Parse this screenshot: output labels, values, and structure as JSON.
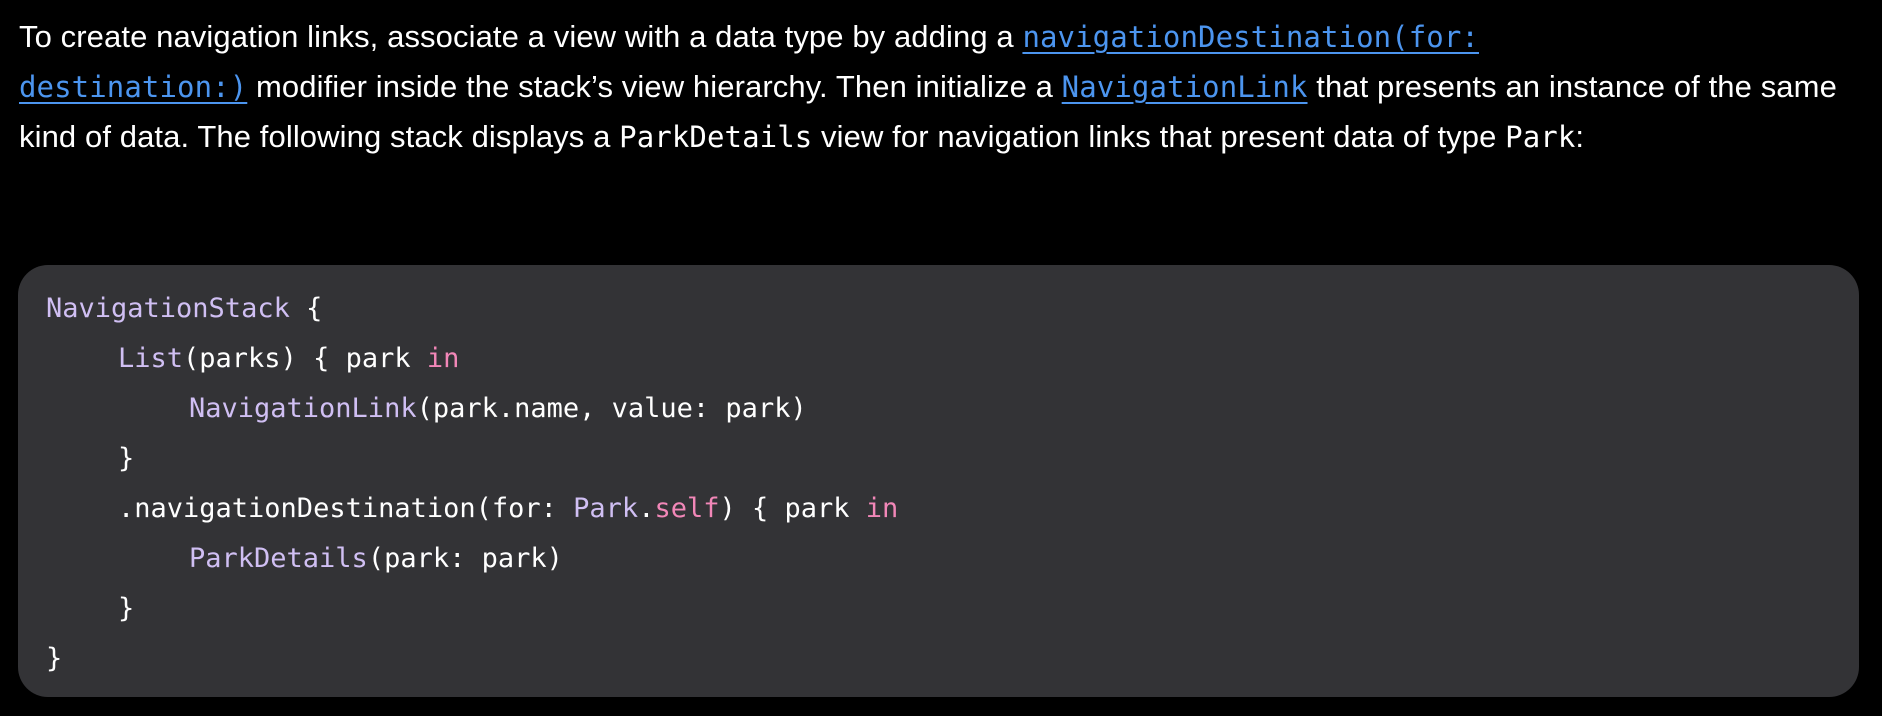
{
  "paragraph": {
    "t1": "To create navigation links, associate a view with a data type by adding a ",
    "link1": "navigationDestination(for:",
    "link1b": "destination:)",
    "t2": " modifier inside the stack’s view hierarchy. Then initialize a ",
    "link2": "NavigationLink",
    "t3": " that presents an instance of the same kind of data. The following stack displays a ",
    "code1": "ParkDetails",
    "t4": " view for navigation links that present data of type ",
    "code2": "Park",
    "t5": ":"
  },
  "code": {
    "l1_type": "NavigationStack",
    "l1_rest": " {",
    "l2_type": "List",
    "l2_rest": "(parks) { park ",
    "l2_kw": "in",
    "l3_type": "NavigationLink",
    "l3_rest": "(park.name, value: park)",
    "l4": "}",
    "l5_a": ".navigationDestination(for: ",
    "l5_type": "Park",
    "l5_dot": ".",
    "l5_kw1": "self",
    "l5_b": ") { park ",
    "l5_kw2": "in",
    "l6_type": "ParkDetails",
    "l6_rest": "(park: park)",
    "l7": "}",
    "l8": "}"
  },
  "colors": {
    "background": "#000000",
    "code_background": "#333336",
    "link": "#4c95ef",
    "type": "#d0bff3",
    "keyword": "#f287b8"
  }
}
